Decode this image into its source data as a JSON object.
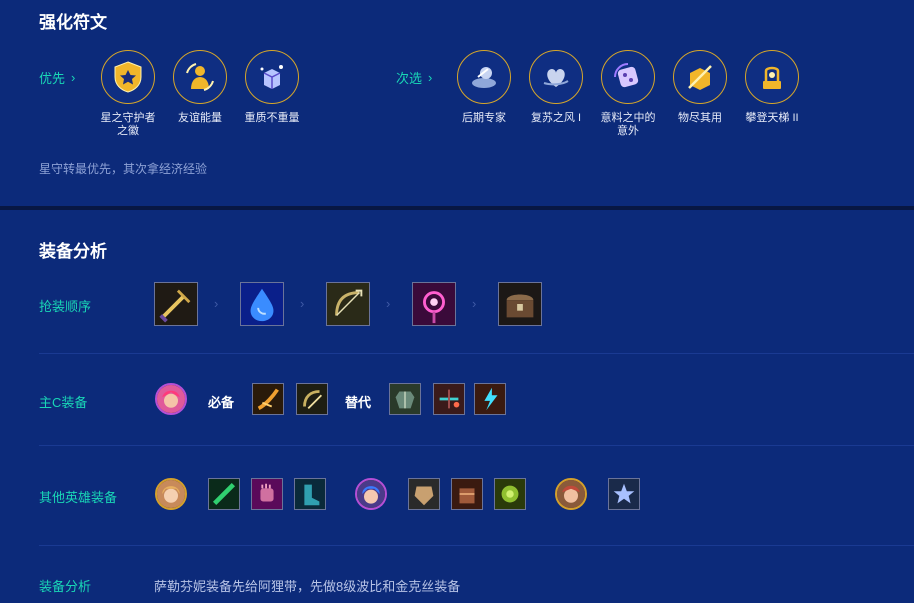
{
  "runes": {
    "title": "强化符文",
    "primary_label": "优先",
    "secondary_label": "次选",
    "primary": [
      {
        "name": "星之守护者之徽",
        "icon": "star-guardian-emblem-icon"
      },
      {
        "name": "友谊能量",
        "icon": "friendship-energy-icon"
      },
      {
        "name": "重质不重量",
        "icon": "quality-over-quantity-icon"
      }
    ],
    "secondary": [
      {
        "name": "后期专家",
        "icon": "late-game-expert-icon"
      },
      {
        "name": "复苏之风 I",
        "icon": "healing-wind-icon"
      },
      {
        "name": "意料之中的意外",
        "icon": "expected-surprise-icon"
      },
      {
        "name": "物尽其用",
        "icon": "make-use-icon"
      },
      {
        "name": "攀登天梯 II",
        "icon": "climb-ladder-icon"
      }
    ],
    "note": "星守转最优先，其次拿经济经验"
  },
  "items": {
    "title": "装备分析",
    "order_label": "抢装顺序",
    "order_icons": [
      "sword-item-icon",
      "tear-item-icon",
      "bow-item-icon",
      "magic-orb-item-icon",
      "chest-item-icon"
    ],
    "carry_label": "主C装备",
    "required_label": "必备",
    "alt_label": "替代",
    "carry_required": [
      "sword-blade-item-icon",
      "bow-blade-item-icon"
    ],
    "carry_alternatives": [
      "armor-item-icon",
      "crossbow-item-icon",
      "lightning-item-icon"
    ],
    "others_label": "其他英雄装备",
    "analysis_label": "装备分析",
    "analysis_text": "萨勒芬妮装备先给阿狸带，先做8级波比和金克丝装备"
  },
  "colors": {
    "background": "#0c2a7a",
    "accent": "#19d6b6",
    "gold_ring": "#d6a62a",
    "note": "#8ea2d6"
  }
}
